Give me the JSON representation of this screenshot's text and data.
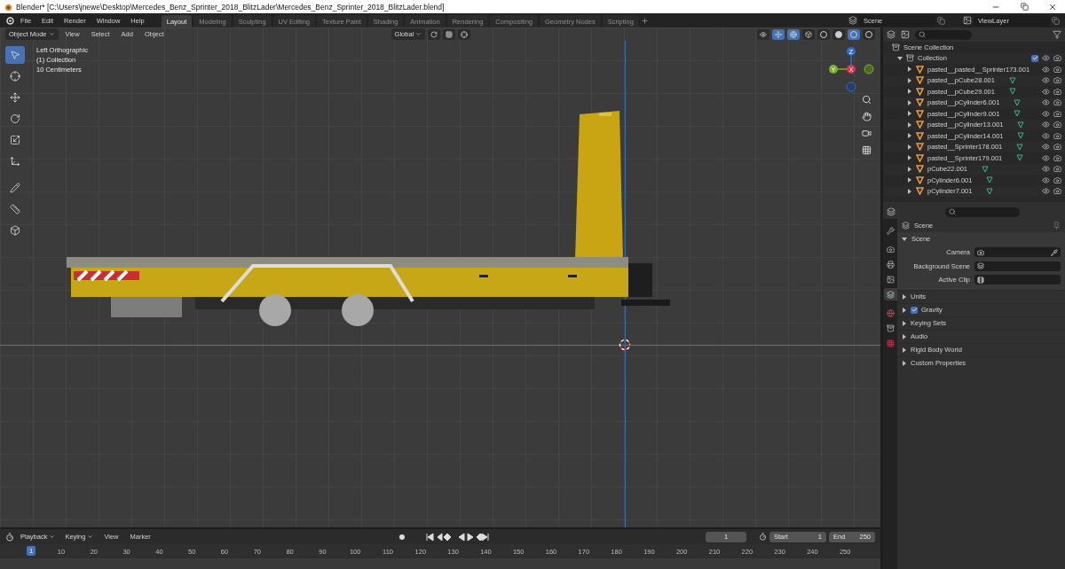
{
  "window": {
    "title": "Blender* [C:\\Users\\jnewe\\Desktop\\Mercedes_Benz_Sprinter_2018_BlitzLader\\Mercedes_Benz_Sprinter_2018_BlitzLader.blend]"
  },
  "menu": [
    "File",
    "Edit",
    "Render",
    "Window",
    "Help"
  ],
  "workspaces": [
    {
      "label": "Layout",
      "selected": true
    },
    {
      "label": "Modeling",
      "selected": false
    },
    {
      "label": "Sculpting",
      "selected": false
    },
    {
      "label": "UV Editing",
      "selected": false
    },
    {
      "label": "Texture Paint",
      "selected": false
    },
    {
      "label": "Shading",
      "selected": false
    },
    {
      "label": "Animation",
      "selected": false
    },
    {
      "label": "Rendering",
      "selected": false
    },
    {
      "label": "Compositing",
      "selected": false
    },
    {
      "label": "Geometry Nodes",
      "selected": false
    },
    {
      "label": "Scripting",
      "selected": false
    }
  ],
  "scene": "Scene",
  "view_layer": "ViewLayer",
  "viewport": {
    "mode": "Object Mode",
    "menus": [
      "View",
      "Select",
      "Add",
      "Object"
    ],
    "orientation": "Global",
    "overlay_text": [
      "Left Orthographic",
      "(1) Collection",
      "10 Centimeters"
    ],
    "tools": [
      {
        "kind": "select",
        "selected": true
      },
      {
        "kind": "cursor",
        "selected": false
      },
      {
        "kind": "move",
        "selected": false
      },
      {
        "kind": "rotate",
        "selected": false
      },
      {
        "kind": "scale",
        "selected": false
      },
      {
        "kind": "transform",
        "selected": false
      },
      {
        "kind": "annotate",
        "selected": false
      },
      {
        "kind": "measure",
        "selected": false
      },
      {
        "kind": "add",
        "selected": false
      }
    ],
    "gizmo": {
      "z": "Z",
      "y": "Y",
      "x": "X"
    },
    "shading": [
      {
        "selected": false
      },
      {
        "selected": false
      },
      {
        "selected": true
      },
      {
        "selected": false
      }
    ]
  },
  "outliner": {
    "root": "Scene Collection",
    "collection": {
      "name": "Collection",
      "checked": true,
      "expanded": true,
      "children": [
        {
          "name": "pasted__pasted__Sprinter173.001",
          "has_mesh": false
        },
        {
          "name": "pasted__pCube28.001",
          "has_mesh": true
        },
        {
          "name": "pasted__pCube29.001",
          "has_mesh": true
        },
        {
          "name": "pasted__pCylinder6.001",
          "has_mesh": true
        },
        {
          "name": "pasted__pCylinder9.001",
          "has_mesh": true
        },
        {
          "name": "pasted__pCylinder13.001",
          "has_mesh": true
        },
        {
          "name": "pasted__pCylinder14.001",
          "has_mesh": true
        },
        {
          "name": "pasted__Sprinter178.001",
          "has_mesh": true
        },
        {
          "name": "pasted__Sprinter179.001",
          "has_mesh": true
        },
        {
          "name": "pCube22.001",
          "has_mesh": true
        },
        {
          "name": "pCylinder6.001",
          "has_mesh": true
        },
        {
          "name": "pCylinder7.001",
          "has_mesh": true
        }
      ]
    }
  },
  "properties": {
    "title": "Scene",
    "tabs": [
      {
        "kind": "tool",
        "selected": false
      },
      {
        "kind": "render",
        "selected": false
      },
      {
        "kind": "output",
        "selected": false
      },
      {
        "kind": "view_layer",
        "selected": false
      },
      {
        "kind": "scene",
        "selected": true
      },
      {
        "kind": "world",
        "selected": false
      },
      {
        "kind": "collection",
        "selected": false
      },
      {
        "kind": "texture",
        "selected": false
      }
    ],
    "section": {
      "label": "Scene",
      "expanded": true
    },
    "fields": [
      {
        "label": "Camera",
        "kind": "camera"
      },
      {
        "label": "Background Scene",
        "kind": "scene"
      },
      {
        "label": "Active Clip",
        "kind": "clip"
      }
    ],
    "panels": [
      {
        "label": "Units",
        "kind": "plain"
      },
      {
        "label": "Gravity",
        "kind": "checkbox",
        "checked": true
      },
      {
        "label": "Keying Sets",
        "kind": "plain"
      },
      {
        "label": "Audio",
        "kind": "plain"
      },
      {
        "label": "Rigid Body World",
        "kind": "plain"
      },
      {
        "label": "Custom Properties",
        "kind": "plain"
      }
    ]
  },
  "timeline": {
    "menus": [
      "Playback",
      "Keying",
      "View",
      "Marker"
    ],
    "current_frame": "1",
    "start_label": "Start",
    "start": "1",
    "end_label": "End",
    "end": "250",
    "playhead": "1",
    "ticks": [
      "10",
      "20",
      "30",
      "40",
      "50",
      "60",
      "70",
      "80",
      "90",
      "100",
      "110",
      "120",
      "130",
      "140",
      "150",
      "160",
      "170",
      "180",
      "190",
      "200",
      "210",
      "220",
      "230",
      "240",
      "250"
    ]
  }
}
